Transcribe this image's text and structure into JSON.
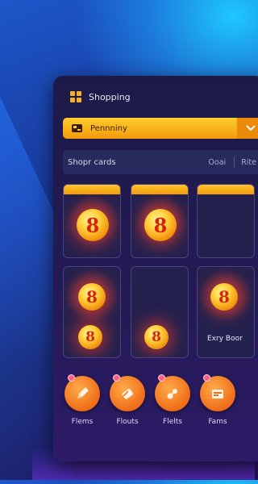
{
  "header": {
    "title": "Shopping",
    "logo_icon": "grid-logo-icon"
  },
  "dropdown": {
    "label": "Pennniny",
    "icon": "tag-icon",
    "chevron_icon": "chevron-down-icon"
  },
  "subbar": {
    "label": "Shopr cards",
    "tabs": [
      "Ooai",
      "Rite"
    ]
  },
  "cards": [
    {
      "label": "",
      "coin_text": "8"
    },
    {
      "label": "",
      "coin_text": "8"
    },
    {
      "label": ""
    },
    {
      "label": "",
      "coin_texts": [
        "8",
        "8"
      ]
    },
    {
      "label": "",
      "coin_text": "8"
    },
    {
      "label": "Exry Boor",
      "coin_text": "8"
    }
  ],
  "actions": [
    {
      "label": "Flems",
      "icon": "pencil-icon"
    },
    {
      "label": "Flouts",
      "icon": "eraser-icon"
    },
    {
      "label": "Flelts",
      "icon": "link-icon"
    },
    {
      "label": "Fams",
      "icon": "card-icon"
    }
  ],
  "colors": {
    "accent": "#f7a81b",
    "action": "#ef6d17",
    "panel": "#1d1a48"
  }
}
